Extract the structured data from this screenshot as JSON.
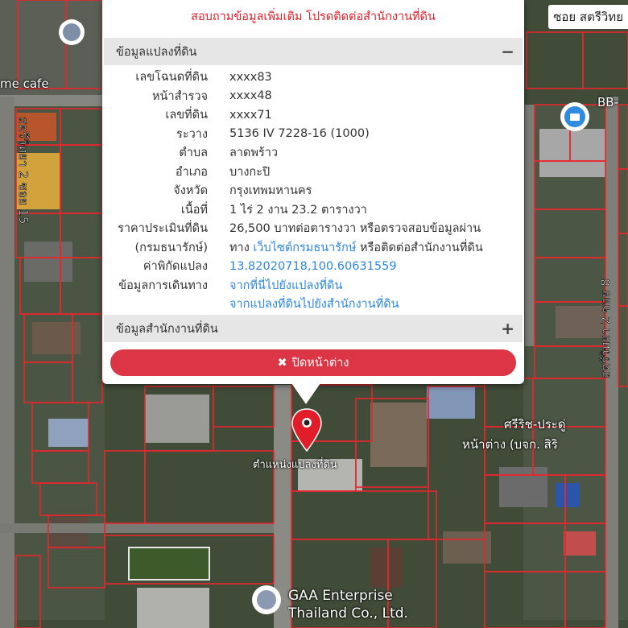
{
  "popup": {
    "notice": "สอบถามข้อมูลเพิ่มเติม โปรดติดต่อสำนักงานที่ดิน",
    "section_land": {
      "title": "ข้อมูลแปลงที่ดิน",
      "toggle": "−"
    },
    "rows": {
      "deed_no": {
        "label": "เลขโฉนดที่ดิน",
        "value": "xxxx83"
      },
      "survey_page": {
        "label": "หน้าสำรวจ",
        "value": "xxxx48"
      },
      "land_no": {
        "label": "เลขที่ดิน",
        "value": "xxxx71"
      },
      "map_sheet": {
        "label": "ระวาง",
        "value": "5136 IV 7228-16 (1000)"
      },
      "subdistrict": {
        "label": "ตำบล",
        "value": "ลาดพร้าว"
      },
      "district": {
        "label": "อำเภอ",
        "value": "บางกะปิ"
      },
      "province": {
        "label": "จังหวัด",
        "value": "กรุงเทพมหานคร"
      },
      "area": {
        "label": "เนื้อที่",
        "value": "1 ไร่ 2 งาน 23.2 ตารางวา"
      },
      "appraisal": {
        "label": "ราคาประเมินที่ดิน",
        "value": "26,500 บาทต่อตารางวา หรือตรวจสอบข้อมูลผ่าน",
        "label2": "(กรมธนารักษ์)",
        "prefix": "ทาง ",
        "link": "เว็บไซต์กรมธนารักษ์",
        "suffix": " หรือติดต่อสำนักงานที่ดิน"
      },
      "coordinates": {
        "label": "ค่าพิกัดแปลง",
        "value": "13.82020718,100.60631559"
      },
      "directions": {
        "label": "ข้อมูลการเดินทาง",
        "link1": "จากที่นี่ไปยังแปลงที่ดิน",
        "link2": "จากแปลงที่ดินไปยังสำนักงานที่ดิน"
      }
    },
    "section_office": {
      "title": "ข้อมูลสำนักงานที่ดิน",
      "toggle": "+"
    },
    "close_label": "ปิดหน้าต่าง",
    "close_icon": "✖"
  },
  "map": {
    "labels": {
      "street_top_right": "ซอย สตรีวิทย",
      "cafe": "me cafe",
      "bb": "BB-",
      "sri_rit": "ศรีริช-ประดู่",
      "na_tang": "หน้าต่าง (บจก. สิริ",
      "plot_location": "ตำแหน่งแปลงที่ดิน",
      "gaa1": "GAA Enterprise",
      "gaa2": "Thailand Co., Ltd."
    }
  }
}
